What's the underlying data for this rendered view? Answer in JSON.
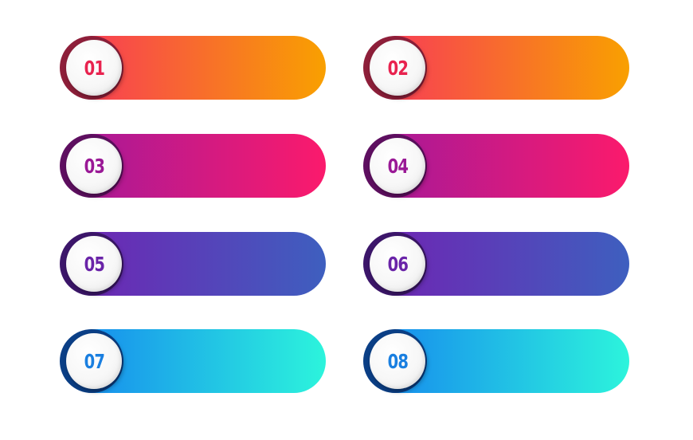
{
  "items": [
    {
      "number": "01",
      "gradient": [
        "#f7345d",
        "#f9a000"
      ],
      "ring": "#8e1f3a",
      "text_color": "#e8234f"
    },
    {
      "number": "02",
      "gradient": [
        "#f7345d",
        "#f9a000"
      ],
      "ring": "#8e1f3a",
      "text_color": "#e8234f"
    },
    {
      "number": "03",
      "gradient": [
        "#a1199b",
        "#fb1a6c"
      ],
      "ring": "#5e0f60",
      "text_color": "#9a1996"
    },
    {
      "number": "04",
      "gradient": [
        "#a1199b",
        "#fb1a6c"
      ],
      "ring": "#5e0f60",
      "text_color": "#9a1996"
    },
    {
      "number": "05",
      "gradient": [
        "#7221b2",
        "#3e5fbf"
      ],
      "ring": "#3c166a",
      "text_color": "#6a24a8"
    },
    {
      "number": "06",
      "gradient": [
        "#7221b2",
        "#3e5fbf"
      ],
      "ring": "#3c166a",
      "text_color": "#6a24a8"
    },
    {
      "number": "07",
      "gradient": [
        "#1584ef",
        "#2cf4dc"
      ],
      "ring": "#0b3f86",
      "text_color": "#1a7fe0"
    },
    {
      "number": "08",
      "gradient": [
        "#1584ef",
        "#2cf4dc"
      ],
      "ring": "#0b3f86",
      "text_color": "#1a7fe0"
    }
  ]
}
